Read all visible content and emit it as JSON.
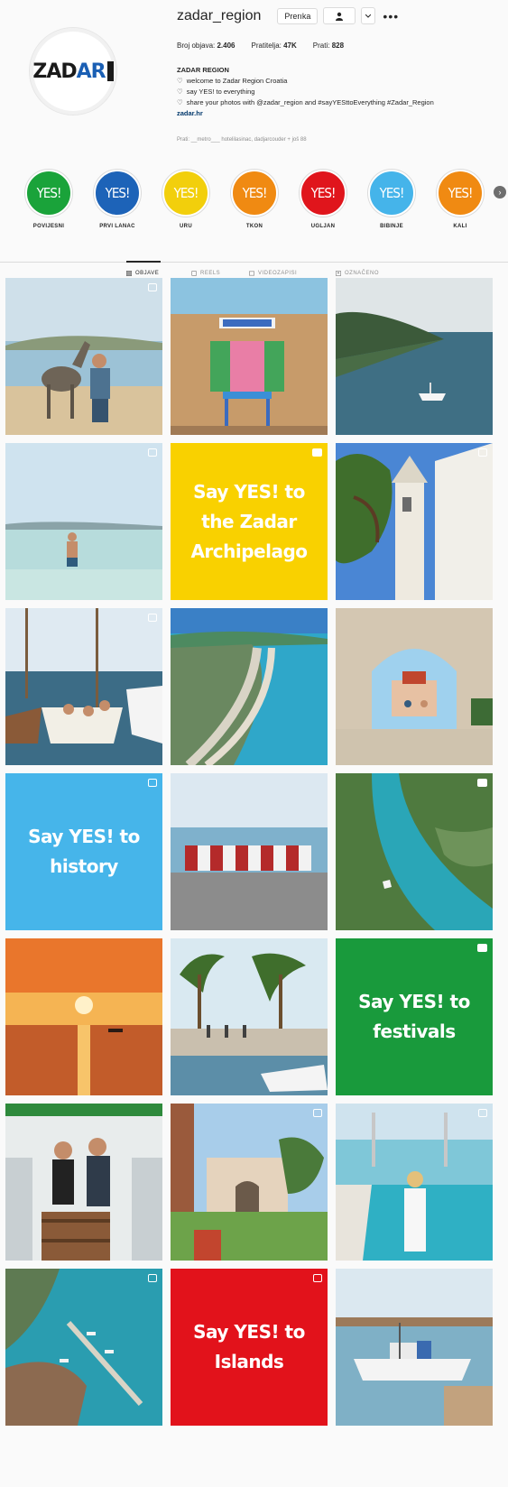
{
  "profile": {
    "username": "zadar_region",
    "follow_label": "Prerıka",
    "stats": [
      {
        "label": "Broj objava:",
        "value": "2.406"
      },
      {
        "label": "Pratitelja:",
        "value": "47K"
      },
      {
        "label": "Prati:",
        "value": "828"
      }
    ],
    "bio_name": "ZADAR REGION",
    "bio_lines": [
      "welcome to Zadar Region Croatia",
      "say YES! to everything",
      "share your photos with @zadar_region and #sayYESttoEverything #Zadar_Region"
    ],
    "bio_link": "zadar.hr",
    "followed_by": "Prati: __metro___ hotelilasinac, dadjarcouder + još 88",
    "logo_text_1": "ZAD",
    "logo_text_2": "AR"
  },
  "highlights": [
    {
      "label": "POVIJESNI",
      "text": "YES!",
      "color": "#1aa33a"
    },
    {
      "label": "PRVI LANAC",
      "text": "YES!",
      "color": "#1d63b8"
    },
    {
      "label": "URU",
      "text": "YES!",
      "color": "#f2cf0c"
    },
    {
      "label": "TKON",
      "text": "YES!",
      "color": "#f08a12"
    },
    {
      "label": "UGLJAN",
      "text": "YES!",
      "color": "#e0151c"
    },
    {
      "label": "BIBINJE",
      "text": "YES!",
      "color": "#45b4ea"
    },
    {
      "label": "KALI",
      "text": "YES!",
      "color": "#f08a12"
    }
  ],
  "tabs": [
    {
      "label": "OBJAVE",
      "active": true
    },
    {
      "label": "REELS",
      "active": false
    },
    {
      "label": "VIDEOZAPISI",
      "active": false
    },
    {
      "label": "OZNAČENO",
      "active": false
    }
  ],
  "posts": [
    {
      "kind": "photo",
      "scene": "donkey-beach",
      "mark": "square"
    },
    {
      "kind": "photo",
      "scene": "house-window",
      "mark": "none"
    },
    {
      "kind": "photo",
      "scene": "coast-boat",
      "mark": "none"
    },
    {
      "kind": "photo",
      "scene": "man-shallow-sea",
      "mark": "square"
    },
    {
      "kind": "text",
      "text": "Say YES! to\nthe Zadar\nArchipelago",
      "color": "#f9d100",
      "mark": "igtv"
    },
    {
      "kind": "photo",
      "scene": "church-tower",
      "mark": "square"
    },
    {
      "kind": "photo",
      "scene": "sailboats",
      "mark": "square"
    },
    {
      "kind": "photo",
      "scene": "aerial-coast",
      "mark": "none"
    },
    {
      "kind": "photo",
      "scene": "stone-arch",
      "mark": "none"
    },
    {
      "kind": "text",
      "text": "Say YES! to\nhistory",
      "color": "#46b5ea",
      "mark": "square"
    },
    {
      "kind": "photo",
      "scene": "folk-group",
      "mark": "none"
    },
    {
      "kind": "photo",
      "scene": "canal-aerial",
      "mark": "igtv"
    },
    {
      "kind": "photo",
      "scene": "sunset-sea",
      "mark": "none"
    },
    {
      "kind": "photo",
      "scene": "harbour-palms",
      "mark": "none"
    },
    {
      "kind": "text",
      "text": "Say YES! to\nfestivals",
      "color": "#199a3c",
      "mark": "igtv"
    },
    {
      "kind": "photo",
      "scene": "couple-wine-barrel",
      "mark": "none"
    },
    {
      "kind": "photo",
      "scene": "villa-garden",
      "mark": "square"
    },
    {
      "kind": "photo",
      "scene": "woman-pool",
      "mark": "square"
    },
    {
      "kind": "photo",
      "scene": "aerial-marina",
      "mark": "square"
    },
    {
      "kind": "text",
      "text": "Say YES! to\nIslands",
      "color": "#e2121b",
      "mark": "square"
    },
    {
      "kind": "photo",
      "scene": "fishing-boats",
      "mark": "none"
    }
  ]
}
